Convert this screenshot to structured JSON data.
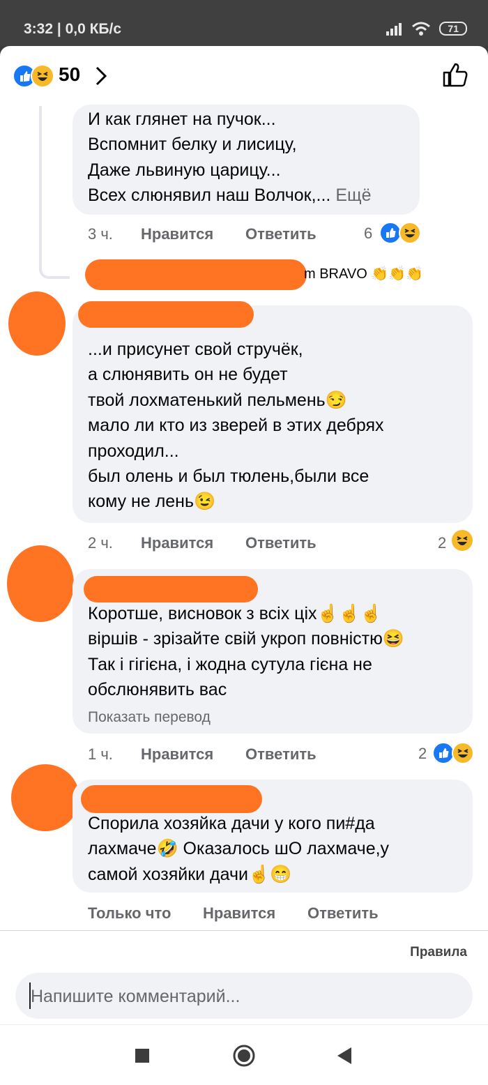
{
  "status": {
    "time_info": "3:32 | 0,0 КБ/с",
    "battery": "71"
  },
  "header": {
    "reaction_count": "50"
  },
  "comments": [
    {
      "text": "И как глянет на пучок...\nВспомнит белку и лисицу,\nДаже львиную царицу...\nВсех слюнявил наш Волчок,...",
      "more": "Ещё",
      "time": "3 ч.",
      "like": "Нравится",
      "reply": "Ответить",
      "reactions": "6"
    },
    {
      "text": "...и присунет свой стручёк,\nа слюнявить он не будет\nтвой лохматенький пельмень😏\nмало ли кто из зверей в этих дебрях\nпроходил...\nбыл олень и был тюлень,были все\nкому не лень😉",
      "time": "2 ч.",
      "like": "Нравится",
      "reply": "Ответить",
      "reactions": "2"
    },
    {
      "text": "Коротше, висновок з всіх ціх☝☝☝\nвіршів - зрізайте свій укроп повністю😆\nТак і гігієна, і жодна сутула гієна не\nобслюнявить вас",
      "translate": "Показать перевод",
      "time": "1 ч.",
      "like": "Нравится",
      "reply": "Ответить",
      "reactions": "2"
    },
    {
      "text": "Спорила хозяйка дачи у кого пи#да\nлахмаче🤣 Оказалось шО лахмаче,у\nсамой хозяйки дачи☝😁",
      "time": "Только что",
      "like": "Нравится",
      "reply": "Ответить"
    }
  ],
  "reply_preview": {
    "text": "m BRAVO 👏👏👏"
  },
  "footer": {
    "rules": "Правила",
    "placeholder": "Напишите комментарий..."
  },
  "colors": {
    "accent": "#1877f2",
    "bubble": "#f0f2f5",
    "redaction": "#fe7423"
  }
}
